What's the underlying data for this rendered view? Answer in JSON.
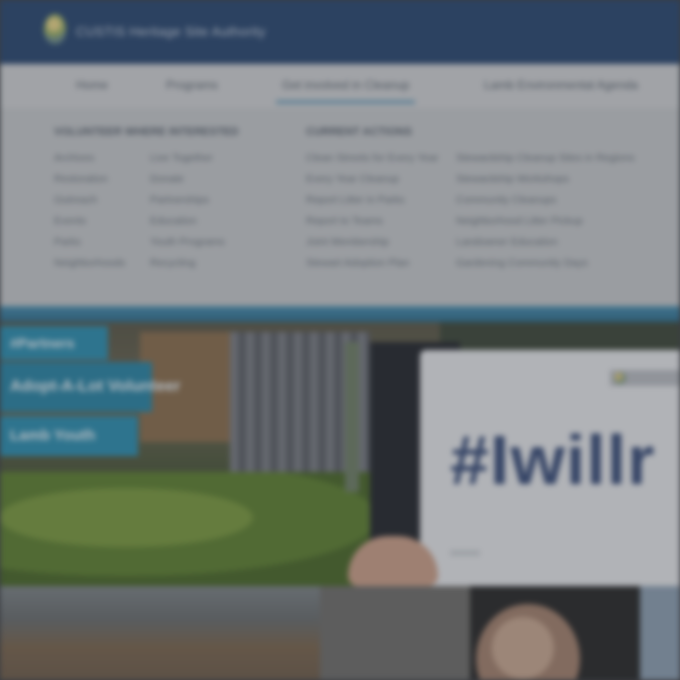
{
  "header": {
    "site_title": "CUSTIS Heritage Site Authority",
    "logo": "leaf-logo-icon"
  },
  "nav": {
    "items": [
      {
        "label": "Home"
      },
      {
        "label": "Programs"
      },
      {
        "label": "Get involved in Cleanup",
        "active": true
      },
      {
        "label": "Lamb Environmental Agenda"
      }
    ]
  },
  "mega_menu": {
    "left_heading": "VOLUNTEER WHERE INTERESTED",
    "left_col_a": [
      "Archives",
      "Restoration",
      "Outreach",
      "Events",
      "Parks",
      "Neighborhoods"
    ],
    "left_col_b": [
      "Live Together",
      "Donate",
      "Partnerships",
      "Education",
      "Youth Programs",
      "Recycling"
    ],
    "right_heading": "CURRENT ACTIONS",
    "right_col_a": [
      "Clean Streets for Every Year",
      "Every Year Cleanup",
      "Report Litter in Parks",
      "Report to Teams",
      "Joint Membership",
      "Stewart Adoption Plan"
    ],
    "right_col_b": [
      "Stewardship Cleanup Sites in Regions",
      "Stewardship Workshops",
      "Community Cleanups",
      "Neighborhood Litter Pickup",
      "Landowner Education",
      "Gardening Community Days"
    ]
  },
  "hero": {
    "badges": [
      "#Partners",
      "Adopt-A-Lot Volunteer",
      "Lamb Youth"
    ],
    "sign_text": "#Iwillr"
  },
  "colors": {
    "header_bg": "#2b4a72",
    "nav_bg": "#cdd0d3",
    "accent_teal": "#2f8fb0",
    "sign_text": "#3b4f7a"
  }
}
